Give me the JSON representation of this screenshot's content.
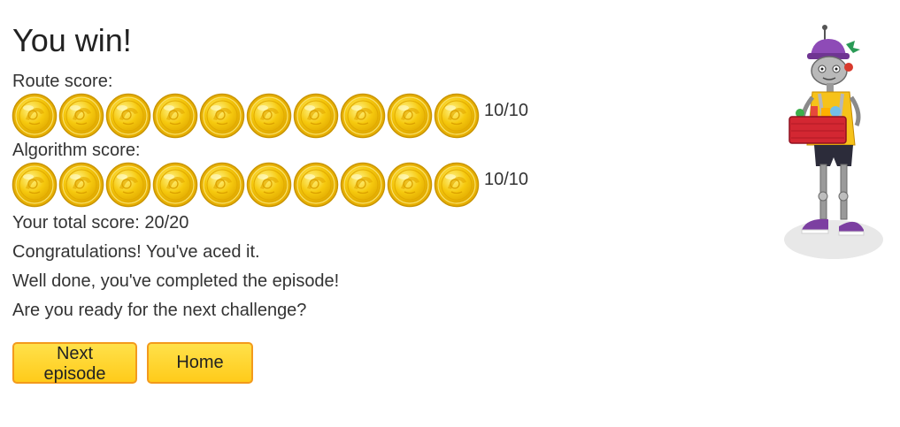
{
  "title": "You win!",
  "route": {
    "label": "Route score:",
    "coins": 10,
    "score": "10/10"
  },
  "algorithm": {
    "label": "Algorithm score:",
    "coins": 10,
    "score": "10/10"
  },
  "total": "Your total score: 20/20",
  "messages": [
    "Congratulations! You've aced it.",
    "Well done, you've completed the episode!",
    "Are you ready for the next challenge?"
  ],
  "buttons": {
    "next_label": "Next episode",
    "home_label": "Home"
  },
  "colors": {
    "coin_gold": "#f6c90e",
    "coin_edge": "#d9a300",
    "button_fill": "#ffd42a",
    "button_border": "#f39a1c"
  },
  "icons": {
    "coin": "gold-coin-icon",
    "mascot": "robot-delivery-mascot"
  }
}
